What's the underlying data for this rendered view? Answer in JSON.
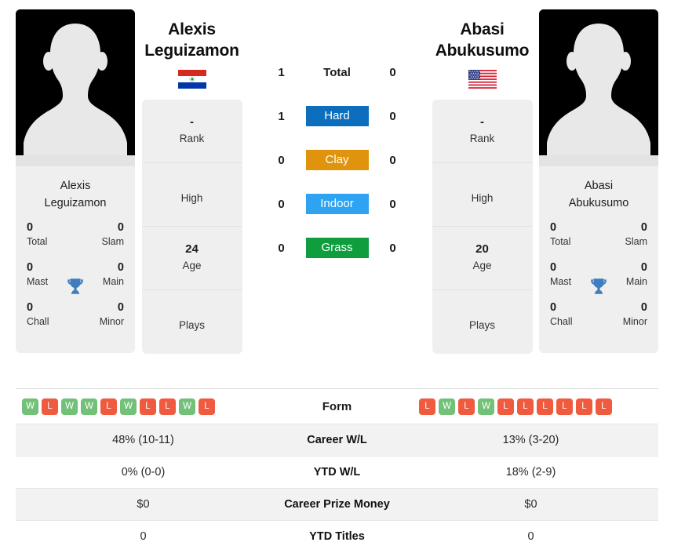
{
  "players": {
    "left": {
      "name_line1": "Alexis",
      "name_line2": "Leguizamon",
      "full_name": "Alexis Leguizamon",
      "country": "Paraguay",
      "flag_icon": "paraguay-flag-icon",
      "photo_alt": "player-silhouette",
      "titles": {
        "total_value": "0",
        "total_label": "Total",
        "slam_value": "0",
        "slam_label": "Slam",
        "mast_value": "0",
        "mast_label": "Mast",
        "main_value": "0",
        "main_label": "Main",
        "chall_value": "0",
        "chall_label": "Chall",
        "minor_value": "0",
        "minor_label": "Minor",
        "trophy_icon": "trophy-icon"
      },
      "info": [
        {
          "value": "-",
          "label": "Rank"
        },
        {
          "value": "",
          "label": "High"
        },
        {
          "value": "24",
          "label": "Age"
        },
        {
          "value": "",
          "label": "Plays"
        }
      ],
      "form": [
        "W",
        "L",
        "W",
        "W",
        "L",
        "W",
        "L",
        "L",
        "W",
        "L"
      ],
      "career_wl": "48% (10-11)",
      "ytd_wl": "0% (0-0)",
      "career_prize_money": "$0",
      "ytd_titles": "0"
    },
    "right": {
      "name_line1": "Abasi",
      "name_line2": "Abukusumo",
      "full_name": "Abasi Abukusumo",
      "country": "United States",
      "flag_icon": "usa-flag-icon",
      "photo_alt": "player-silhouette",
      "titles": {
        "total_value": "0",
        "total_label": "Total",
        "slam_value": "0",
        "slam_label": "Slam",
        "mast_value": "0",
        "mast_label": "Mast",
        "main_value": "0",
        "main_label": "Main",
        "chall_value": "0",
        "chall_label": "Chall",
        "minor_value": "0",
        "minor_label": "Minor",
        "trophy_icon": "trophy-icon"
      },
      "info": [
        {
          "value": "-",
          "label": "Rank"
        },
        {
          "value": "",
          "label": "High"
        },
        {
          "value": "20",
          "label": "Age"
        },
        {
          "value": "",
          "label": "Plays"
        }
      ],
      "form": [
        "L",
        "W",
        "L",
        "W",
        "L",
        "L",
        "L",
        "L",
        "L",
        "L"
      ],
      "career_wl": "13% (3-20)",
      "ytd_wl": "18% (2-9)",
      "career_prize_money": "$0",
      "ytd_titles": "0"
    }
  },
  "head_to_head": {
    "rows": [
      {
        "label": "Total",
        "left": "1",
        "right": "0",
        "type": "total",
        "color": ""
      },
      {
        "label": "Hard",
        "left": "1",
        "right": "0",
        "type": "surface",
        "color": "#0d6ebd"
      },
      {
        "label": "Clay",
        "left": "0",
        "right": "0",
        "type": "surface",
        "color": "#e0940d"
      },
      {
        "label": "Indoor",
        "left": "0",
        "right": "0",
        "type": "surface",
        "color": "#2da3f2"
      },
      {
        "label": "Grass",
        "left": "0",
        "right": "0",
        "type": "surface",
        "color": "#0f9d3d"
      }
    ]
  },
  "form_section": {
    "label": "Form"
  },
  "stats_table": {
    "rows": [
      {
        "label": "Career W/L",
        "left": "48% (10-11)",
        "right": "13% (3-20)"
      },
      {
        "label": "YTD W/L",
        "left": "0% (0-0)",
        "right": "18% (2-9)"
      },
      {
        "label": "Career Prize Money",
        "left": "$0",
        "right": "$0"
      },
      {
        "label": "YTD Titles",
        "left": "0",
        "right": "0"
      }
    ]
  },
  "theme": {
    "win_color": "#73c178",
    "loss_color": "#f05a3f",
    "card_bg": "#efefef",
    "stripe_bg": "#f2f2f2"
  }
}
